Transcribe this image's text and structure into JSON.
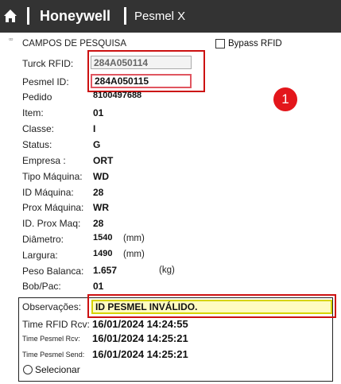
{
  "header": {
    "brand": "Honeywell",
    "app_title": "Pesmel X"
  },
  "search": {
    "section_title": "CAMPOS DE PESQUISA",
    "bypass_label": "Bypass RFID",
    "turck_label": "Turck RFID:",
    "turck_value": "284A050114",
    "pesmel_label": "Pesmel ID:",
    "pesmel_value": "284A050115"
  },
  "annotation": {
    "badge_number": "1"
  },
  "details": {
    "pedido_label": "Pedido",
    "pedido_value": "8100497688",
    "item_label": "Item:",
    "item_value": "01",
    "classe_label": "Classe:",
    "classe_value": "I",
    "status_label": "Status:",
    "status_value": "G",
    "empresa_label": "Empresa :",
    "empresa_value": "ORT",
    "tipo_label": "Tipo Máquina:",
    "tipo_value": "WD",
    "id_maquina_label": "ID Máquina:",
    "id_maquina_value": "28",
    "prox_maquina_label": "Prox Máquina:",
    "prox_maquina_value": "WR",
    "id_prox_label": "ID. Prox Maq:",
    "id_prox_value": "28",
    "diametro_label": "Diâmetro:",
    "diametro_value": "1540",
    "diametro_unit": "(mm)",
    "largura_label": "Largura:",
    "largura_value": "1490",
    "largura_unit": "(mm)",
    "peso_label": "Peso Balanca:",
    "peso_value": "1.657",
    "peso_unit": "(kg)",
    "bob_label": "Bob/Pac:",
    "bob_value": "01"
  },
  "observations": {
    "obs_label": "Observações:",
    "obs_value": "ID PESMEL INVÁLIDO.",
    "time_rfid_label": "Time RFID Rcv:",
    "time_rfid_value": "16/01/2024 14:24:55",
    "time_pesmel_rcv_label": "Time Pesmel Rcv:",
    "time_pesmel_rcv_value": "16/01/2024 14:25:21",
    "time_pesmel_send_label": "Time Pesmel Send:",
    "time_pesmel_send_value": "16/01/2024 14:25:21",
    "selecionar_label": "Selecionar"
  },
  "colors": {
    "topbar": "#333333",
    "highlight_red": "#cc1111",
    "badge_red": "#e3161b",
    "obs_field_bg": "#fffbc2",
    "obs_field_border": "#d6d400"
  },
  "icons": {
    "home": "home-icon"
  }
}
